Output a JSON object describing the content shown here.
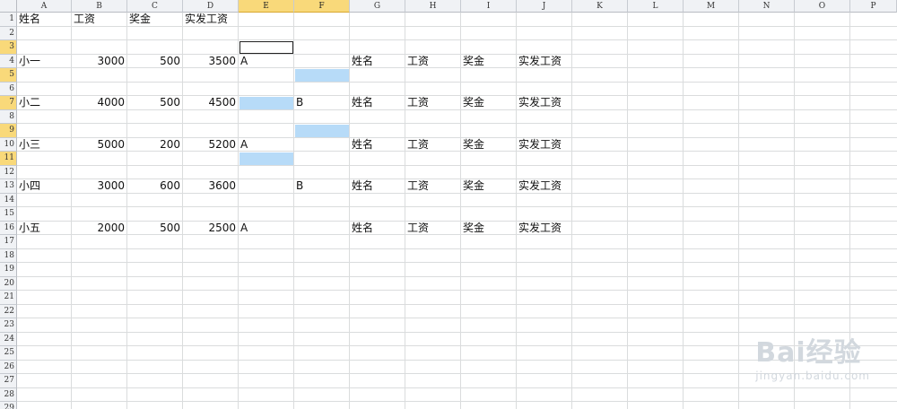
{
  "columns": [
    "A",
    "B",
    "C",
    "D",
    "E",
    "F",
    "G",
    "H",
    "I",
    "J",
    "K",
    "L",
    "M",
    "N",
    "O",
    "P"
  ],
  "selected_columns": [
    "E",
    "F"
  ],
  "rows": [
    "1",
    "2",
    "3",
    "4",
    "5",
    "6",
    "7",
    "8",
    "9",
    "10",
    "11",
    "12",
    "13",
    "14",
    "15",
    "16",
    "17",
    "18",
    "19",
    "20",
    "21",
    "22",
    "23",
    "24",
    "25",
    "26",
    "27",
    "28",
    "29"
  ],
  "selected_rows": [
    "3",
    "5",
    "7",
    "9",
    "11"
  ],
  "cells": [
    {
      "ref": "A1",
      "col": "A",
      "row": 1,
      "value": "姓名",
      "align": "left"
    },
    {
      "ref": "B1",
      "col": "B",
      "row": 1,
      "value": "工资",
      "align": "left"
    },
    {
      "ref": "C1",
      "col": "C",
      "row": 1,
      "value": "奖金",
      "align": "left"
    },
    {
      "ref": "D1",
      "col": "D",
      "row": 1,
      "value": "实发工资",
      "align": "left"
    },
    {
      "ref": "A4",
      "col": "A",
      "row": 4,
      "value": "小一",
      "align": "left"
    },
    {
      "ref": "B4",
      "col": "B",
      "row": 4,
      "value": "3000",
      "align": "right"
    },
    {
      "ref": "C4",
      "col": "C",
      "row": 4,
      "value": "500",
      "align": "right"
    },
    {
      "ref": "D4",
      "col": "D",
      "row": 4,
      "value": "3500",
      "align": "right"
    },
    {
      "ref": "E4",
      "col": "E",
      "row": 4,
      "value": "A",
      "align": "left"
    },
    {
      "ref": "G4",
      "col": "G",
      "row": 4,
      "value": "姓名",
      "align": "left"
    },
    {
      "ref": "H4",
      "col": "H",
      "row": 4,
      "value": "工资",
      "align": "left"
    },
    {
      "ref": "I4",
      "col": "I",
      "row": 4,
      "value": "奖金",
      "align": "left"
    },
    {
      "ref": "J4",
      "col": "J",
      "row": 4,
      "value": "实发工资",
      "align": "left"
    },
    {
      "ref": "A7",
      "col": "A",
      "row": 7,
      "value": "小二",
      "align": "left"
    },
    {
      "ref": "B7",
      "col": "B",
      "row": 7,
      "value": "4000",
      "align": "right"
    },
    {
      "ref": "C7",
      "col": "C",
      "row": 7,
      "value": "500",
      "align": "right"
    },
    {
      "ref": "D7",
      "col": "D",
      "row": 7,
      "value": "4500",
      "align": "right"
    },
    {
      "ref": "F7",
      "col": "F",
      "row": 7,
      "value": "B",
      "align": "left"
    },
    {
      "ref": "G7",
      "col": "G",
      "row": 7,
      "value": "姓名",
      "align": "left"
    },
    {
      "ref": "H7",
      "col": "H",
      "row": 7,
      "value": "工资",
      "align": "left"
    },
    {
      "ref": "I7",
      "col": "I",
      "row": 7,
      "value": "奖金",
      "align": "left"
    },
    {
      "ref": "J7",
      "col": "J",
      "row": 7,
      "value": "实发工资",
      "align": "left"
    },
    {
      "ref": "A10",
      "col": "A",
      "row": 10,
      "value": "小三",
      "align": "left"
    },
    {
      "ref": "B10",
      "col": "B",
      "row": 10,
      "value": "5000",
      "align": "right"
    },
    {
      "ref": "C10",
      "col": "C",
      "row": 10,
      "value": "200",
      "align": "right"
    },
    {
      "ref": "D10",
      "col": "D",
      "row": 10,
      "value": "5200",
      "align": "right"
    },
    {
      "ref": "E10",
      "col": "E",
      "row": 10,
      "value": "A",
      "align": "left"
    },
    {
      "ref": "G10",
      "col": "G",
      "row": 10,
      "value": "姓名",
      "align": "left"
    },
    {
      "ref": "H10",
      "col": "H",
      "row": 10,
      "value": "工资",
      "align": "left"
    },
    {
      "ref": "I10",
      "col": "I",
      "row": 10,
      "value": "奖金",
      "align": "left"
    },
    {
      "ref": "J10",
      "col": "J",
      "row": 10,
      "value": "实发工资",
      "align": "left"
    },
    {
      "ref": "A13",
      "col": "A",
      "row": 13,
      "value": "小四",
      "align": "left"
    },
    {
      "ref": "B13",
      "col": "B",
      "row": 13,
      "value": "3000",
      "align": "right"
    },
    {
      "ref": "C13",
      "col": "C",
      "row": 13,
      "value": "600",
      "align": "right"
    },
    {
      "ref": "D13",
      "col": "D",
      "row": 13,
      "value": "3600",
      "align": "right"
    },
    {
      "ref": "F13",
      "col": "F",
      "row": 13,
      "value": "B",
      "align": "left"
    },
    {
      "ref": "G13",
      "col": "G",
      "row": 13,
      "value": "姓名",
      "align": "left"
    },
    {
      "ref": "H13",
      "col": "H",
      "row": 13,
      "value": "工资",
      "align": "left"
    },
    {
      "ref": "I13",
      "col": "I",
      "row": 13,
      "value": "奖金",
      "align": "left"
    },
    {
      "ref": "J13",
      "col": "J",
      "row": 13,
      "value": "实发工资",
      "align": "left"
    },
    {
      "ref": "A16",
      "col": "A",
      "row": 16,
      "value": "小五",
      "align": "left"
    },
    {
      "ref": "B16",
      "col": "B",
      "row": 16,
      "value": "2000",
      "align": "right"
    },
    {
      "ref": "C16",
      "col": "C",
      "row": 16,
      "value": "500",
      "align": "right"
    },
    {
      "ref": "D16",
      "col": "D",
      "row": 16,
      "value": "2500",
      "align": "right"
    },
    {
      "ref": "E16",
      "col": "E",
      "row": 16,
      "value": "A",
      "align": "left"
    },
    {
      "ref": "G16",
      "col": "G",
      "row": 16,
      "value": "姓名",
      "align": "left"
    },
    {
      "ref": "H16",
      "col": "H",
      "row": 16,
      "value": "工资",
      "align": "left"
    },
    {
      "ref": "I16",
      "col": "I",
      "row": 16,
      "value": "奖金",
      "align": "left"
    },
    {
      "ref": "J16",
      "col": "J",
      "row": 16,
      "value": "实发工资",
      "align": "left"
    }
  ],
  "selected_cells": [
    {
      "ref": "E3",
      "col": "E",
      "row": 3,
      "active": true
    },
    {
      "ref": "F5",
      "col": "F",
      "row": 5,
      "active": false
    },
    {
      "ref": "E7",
      "col": "E",
      "row": 7,
      "active": false
    },
    {
      "ref": "F9",
      "col": "F",
      "row": 9,
      "active": false
    },
    {
      "ref": "E11",
      "col": "E",
      "row": 11,
      "active": false
    }
  ],
  "colors": {
    "selection": "#b7dbf8",
    "header_selected": "#f9d97a",
    "grid": "#dadcdd"
  },
  "watermark": {
    "main": "Bai经验",
    "sub": "jingyan.baidu.com",
    "icon": "paw-icon"
  }
}
